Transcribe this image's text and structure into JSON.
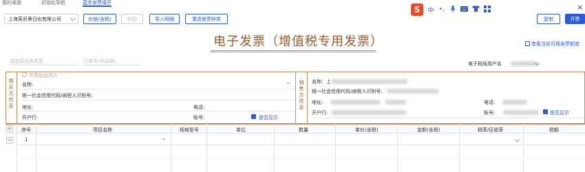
{
  "tabs": [
    {
      "label": "我的桌面",
      "active": false
    },
    {
      "label": "初始化导航",
      "active": false
    },
    {
      "label": "蓝字发票填开",
      "active": true
    }
  ],
  "toolbar": {
    "company": "上海英尼蒂日化有限公司",
    "price_button": "价格(含税)",
    "discount_button": "折扣",
    "import_button": "导入明细",
    "reselect_button": "重选发票种类",
    "copy_button": "复制",
    "issue_button": "开票"
  },
  "ime": {
    "items": [
      "中",
      "•,",
      "🎤",
      "⌨",
      "👕",
      "⊞"
    ]
  },
  "title": "电子发票（增值税专用发票）",
  "view_quota_link": "查看当前可用发票额度",
  "filters": {
    "business_type_placeholder": "请选择业务类型",
    "order_no_placeholder": "订单号(非必填)",
    "tax_user_label": "电子税局用户名"
  },
  "buyer": {
    "section_label": "购买方信息",
    "natural_person_label": "开票给自然人",
    "name_label": "名称:",
    "tax_id_label": "统一社会信用代码/纳税人识别号:",
    "address_label": "地址:",
    "phone_label": "电话:",
    "bank_label": "开户行:",
    "account_label": "账号:",
    "show_label": "是否显示"
  },
  "seller": {
    "section_label": "销售方信息",
    "name_label": "名称:",
    "name_prefix": "上",
    "tax_id_label": "统一社会信用代码/纳税人识别号:",
    "address_label": "地址:",
    "phone_label": "电话:",
    "bank_label": "开户行:",
    "account_label": "账号:",
    "show_label": "是否显示"
  },
  "table": {
    "columns": [
      "序号",
      "项目名称",
      "规格型号",
      "单位",
      "数量",
      "单价(含税)",
      "金额(含税)",
      "税率/征收率",
      "税额"
    ],
    "rows": [
      {
        "index": "1"
      }
    ],
    "add_label": "+",
    "remove_label": "−"
  },
  "colors": {
    "accent": "#2a5bd7",
    "title": "#9b5a2a",
    "frame": "#c98b5a"
  }
}
